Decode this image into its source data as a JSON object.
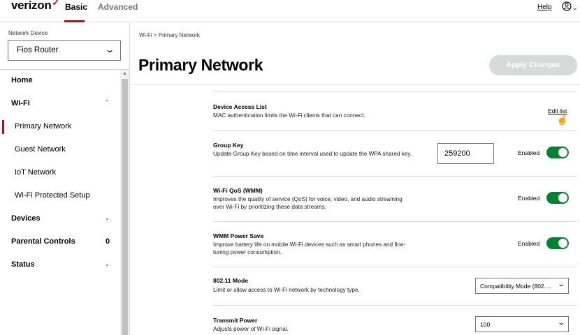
{
  "header": {
    "logo": "verizon",
    "logo_mark": "✓",
    "tabs": [
      {
        "label": "Basic",
        "active": true
      },
      {
        "label": "Advanced",
        "active": false
      }
    ],
    "help": "Help",
    "accent": "#cd040b"
  },
  "sidebar": {
    "device_label": "Network Device",
    "device_selected": "Fios Router",
    "items": [
      {
        "label": "Home"
      },
      {
        "label": "Wi-Fi"
      },
      {
        "label": "Primary Network"
      },
      {
        "label": "Guest Network"
      },
      {
        "label": "IoT Network"
      },
      {
        "label": "Wi-Fi Protected Setup"
      },
      {
        "label": "Devices"
      },
      {
        "label": "Parental Controls",
        "count": "0"
      },
      {
        "label": "Status"
      }
    ]
  },
  "main": {
    "breadcrumb": "Wi-Fi  >  Primary Network",
    "title": "Primary Network",
    "apply_label": "Apply Changes",
    "toggle_color": "#008330",
    "settings": [
      {
        "title": "Device Access List",
        "desc": "MAC authentication limits the Wi-Fi clients that can connect.",
        "link": "Edit list"
      },
      {
        "title": "Group Key",
        "desc": "Update Group Key based on time interval used to update the WPA shared key.",
        "value": "259200",
        "state": "Enabled"
      },
      {
        "title": "Wi-Fi QoS (WMM)",
        "desc": "Improves the quality of service (QoS) for voice, video, and audio streaming over Wi-Fi by prioritizing these data streams.",
        "state": "Enabled"
      },
      {
        "title": "WMM Power Save",
        "desc": "Improve battery life on mobile Wi-Fi devices such as smart phones and fine-tuning power consumption.",
        "state": "Enabled"
      },
      {
        "title": "802.11 Mode",
        "desc": "Limit or allow access to Wi-Fi network by technology type.",
        "select": "Compatibility Mode (802...."
      },
      {
        "title": "Transmit Power",
        "desc": "Adjusts power of Wi-Fi signal.",
        "select": "100"
      }
    ]
  }
}
